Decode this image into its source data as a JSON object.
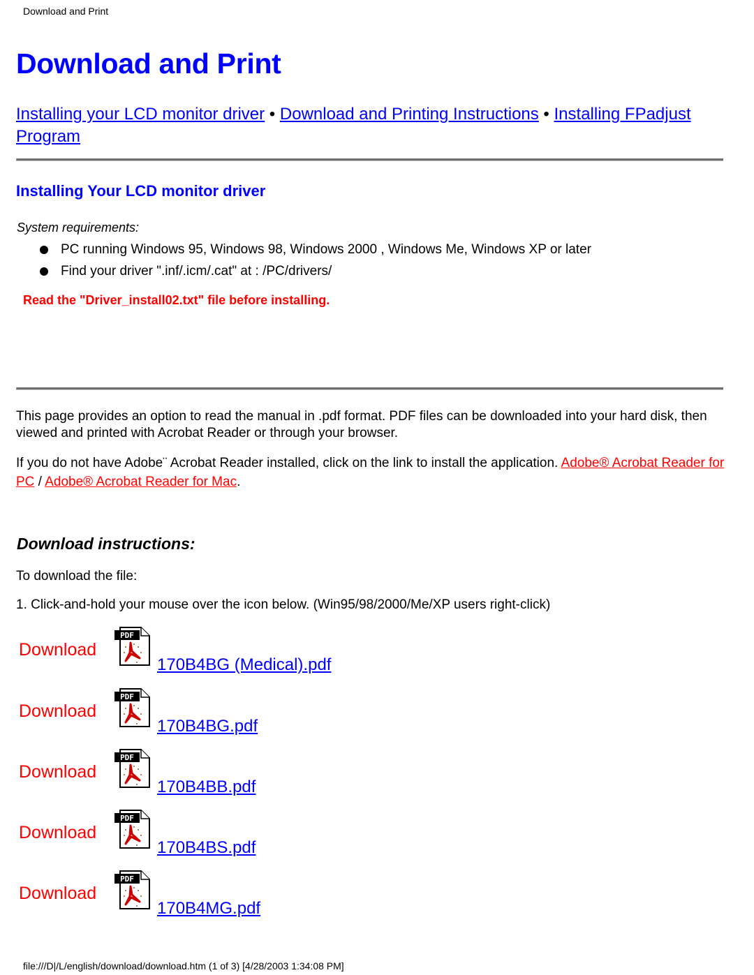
{
  "header": {
    "title": "Download and Print"
  },
  "page_title": "Download and Print",
  "nav": {
    "links": [
      {
        "label": "Installing your LCD monitor driver"
      },
      {
        "label": "Download and Printing Instructions"
      },
      {
        "label": "Installing FPadjust Program"
      }
    ],
    "separator": " • "
  },
  "driver_section": {
    "heading": "Installing Your LCD monitor driver",
    "sysreq_label": "System requirements:",
    "requirements": [
      "PC running Windows 95, Windows 98, Windows 2000 , Windows Me, Windows XP or later",
      "Find your driver \".inf/.icm/.cat\" at : /PC/drivers/"
    ],
    "warning": "Read the \"Driver_install02.txt\" file before installing."
  },
  "pdf_section": {
    "intro": "This page provides an option to read the manual in .pdf format. PDF files can be downloaded into your hard disk, then viewed and printed with Acrobat Reader or through your browser.",
    "adobe_text": "If you do not have Adobe¨ Acrobat Reader installed, click on the link to install the application. ",
    "adobe_pc_link": "Adobe® Acrobat Reader for PC",
    "adobe_separator": " / ",
    "adobe_mac_link": "Adobe® Acrobat Reader for Mac",
    "adobe_end": "."
  },
  "download_section": {
    "heading": "Download instructions:",
    "step_intro": "To download the file:",
    "step1": "1. Click-and-hold your mouse over the icon below. (Win95/98/2000/Me/XP users right-click)",
    "downloads": [
      {
        "label": "Download",
        "icon": "pdf-file-icon",
        "file": "170B4BG (Medical).pdf"
      },
      {
        "label": "Download",
        "icon": "pdf-file-icon",
        "file": "170B4BG.pdf"
      },
      {
        "label": "Download",
        "icon": "pdf-file-icon",
        "file": "170B4BB.pdf"
      },
      {
        "label": "Download",
        "icon": "pdf-file-icon",
        "file": "170B4BS.pdf"
      },
      {
        "label": "Download",
        "icon": "pdf-file-icon",
        "file": "170B4MG.pdf"
      }
    ]
  },
  "footer": {
    "text": "file:///D|/L/english/download/download.htm (1 of 3) [4/28/2003 1:34:08 PM]"
  },
  "colors": {
    "link": "#0000ff",
    "heading": "#0000ff",
    "warning": "#ff0000",
    "download_label": "#ff0000"
  }
}
